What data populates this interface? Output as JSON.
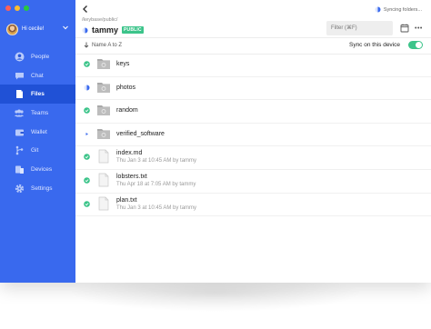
{
  "user": {
    "display_name": "Hi cecile!"
  },
  "sidebar": {
    "items": [
      {
        "label": "People",
        "icon": "people-icon",
        "active": false
      },
      {
        "label": "Chat",
        "icon": "chat-icon",
        "active": false
      },
      {
        "label": "Files",
        "icon": "files-icon",
        "active": true
      },
      {
        "label": "Teams",
        "icon": "teams-icon",
        "active": false
      },
      {
        "label": "Wallet",
        "icon": "wallet-icon",
        "active": false
      },
      {
        "label": "Git",
        "icon": "git-icon",
        "active": false
      },
      {
        "label": "Devices",
        "icon": "devices-icon",
        "active": false
      },
      {
        "label": "Settings",
        "icon": "settings-icon",
        "active": false
      }
    ]
  },
  "header": {
    "sync_status": "Syncing folders...",
    "path": [
      "/keybase",
      "/public",
      "/"
    ],
    "folder_name": "tammy",
    "badge": "PUBLIC",
    "filter_placeholder": "Filter (⌘F)",
    "more": "•••"
  },
  "toolbar": {
    "sort_label": "Name A to Z",
    "sync_device_label": "Sync on this device",
    "sync_on": true
  },
  "files": [
    {
      "name": "keys",
      "type": "folder",
      "status": "synced",
      "meta": ""
    },
    {
      "name": "photos",
      "type": "folder",
      "status": "syncing",
      "meta": ""
    },
    {
      "name": "random",
      "type": "folder",
      "status": "synced",
      "meta": ""
    },
    {
      "name": "verified_software",
      "type": "folder",
      "status": "pending",
      "meta": ""
    },
    {
      "name": "index.md",
      "type": "file",
      "status": "synced",
      "meta": "Thu Jan 3 at 10:45 AM by tammy"
    },
    {
      "name": "lobsters.txt",
      "type": "file",
      "status": "synced",
      "meta": "Thu Apr 18 at 7:05 AM by tammy"
    },
    {
      "name": "plan.txt",
      "type": "file",
      "status": "synced",
      "meta": "Thu Jan 3 at 10:45 AM by tammy"
    }
  ],
  "colors": {
    "sidebar": "#3969ee",
    "sidebar_active": "#2051d6",
    "public_badge": "#3cc48a",
    "synced": "#3cc48a",
    "syncing": "#3969ee"
  }
}
